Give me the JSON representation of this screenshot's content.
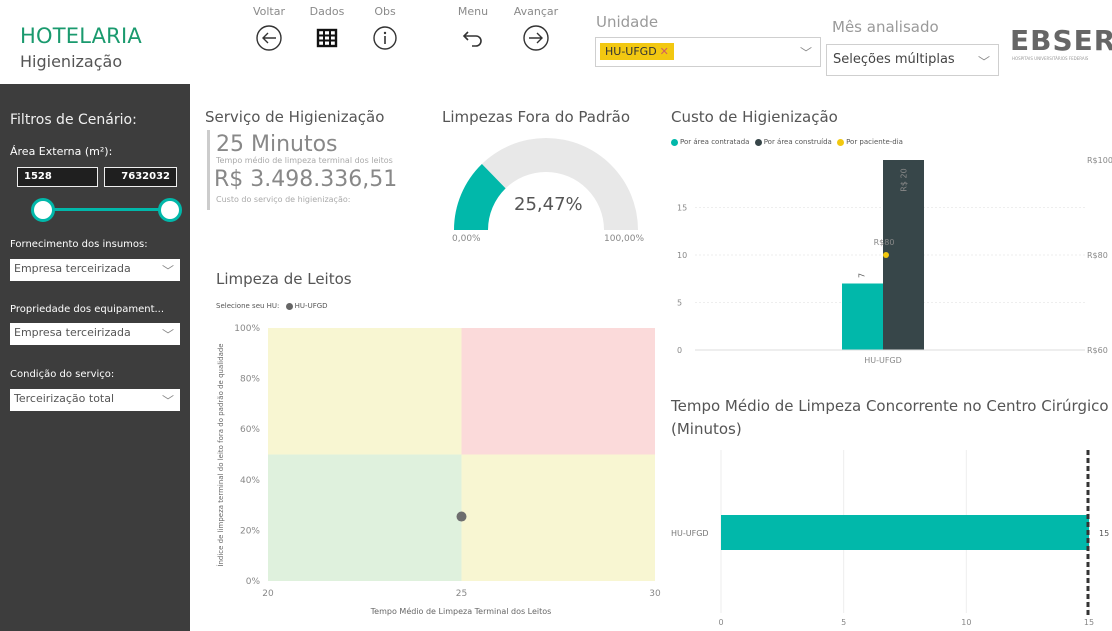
{
  "header": {
    "title": "HOTELARIA",
    "subtitle": "Higienização",
    "nav": [
      {
        "label": "Voltar",
        "icon": "back-arrow-icon"
      },
      {
        "label": "Dados",
        "icon": "table-icon"
      },
      {
        "label": "Obs",
        "icon": "info-icon"
      },
      {
        "label": "Menu",
        "icon": "undo-arrow-icon"
      },
      {
        "label": "Avançar",
        "icon": "forward-arrow-icon"
      }
    ],
    "unidade_label": "Unidade",
    "unidade_chip": "HU-UFGD",
    "mes_label": "Mês analisado",
    "mes_value": "Seleções múltiplas",
    "logo": "EBSERH",
    "logo_sub": "HOSPITAIS UNIVERSITÁRIOS FEDERAIS"
  },
  "sidebar": {
    "title": "Filtros de Cenário:",
    "area_label": "Área Externa (m²):",
    "area_min": "1528",
    "area_max": "7632032",
    "fornecimento_label": "Fornecimento dos insumos:",
    "fornecimento_value": "Empresa terceirizada",
    "propriedade_label": "Propriedade dos equipament...",
    "propriedade_value": "Empresa terceirizada",
    "condicao_label": "Condição do serviço:",
    "condicao_value": "Terceirização total"
  },
  "servico": {
    "title": "Serviço de Higienização",
    "minutes": "25 Minutos",
    "minutes_caption": "Tempo médio de limpeza terminal dos leitos",
    "cost": "R$ 3.498.336,51",
    "cost_caption": "Custo do serviço de higienização:"
  },
  "gauge": {
    "title": "Limpezas Fora do Padrão",
    "value_label": "25,47%",
    "value": 25.47,
    "min_label": "0,00%",
    "max_label": "100,00%",
    "color": "#01b8aa"
  },
  "custo": {
    "title": "Custo de Higienização",
    "legend": [
      {
        "label": "Por área contratada",
        "color": "#01b8aa"
      },
      {
        "label": "Por área construída",
        "color": "#374649"
      },
      {
        "label": "Por paciente-dia",
        "color": "#f2c80f"
      }
    ],
    "y_ticks": [
      "0",
      "5",
      "10",
      "15"
    ],
    "y2_ticks": [
      "R$60",
      "R$80",
      "R$100"
    ],
    "category": "HU-UFGD",
    "bar1_label": "7",
    "bar2_label": "R$ 20",
    "point_label": "R$80"
  },
  "leitos": {
    "title": "Limpeza de Leitos",
    "legend_label": "Selecione seu HU:",
    "legend_item": "HU-UFGD",
    "ylabel": "Índice de limpeza terminal do leito fora do padrão de qualidade",
    "xlabel": "Tempo Médio de Limpeza Terminal dos Leitos",
    "y_ticks": [
      "0%",
      "20%",
      "40%",
      "60%",
      "80%",
      "100%"
    ],
    "x_ticks": [
      "20",
      "25",
      "30"
    ]
  },
  "concorrente": {
    "title_line1": "Tempo Médio de Limpeza Concorrente no Centro Cirúrgico",
    "title_line2": "(Minutos)",
    "category": "HU-UFGD",
    "value_label": "15",
    "x_ticks": [
      "0",
      "5",
      "10",
      "15"
    ]
  },
  "chart_data": [
    {
      "type": "bar",
      "title": "Custo de Higienização",
      "categories": [
        "HU-UFGD"
      ],
      "series": [
        {
          "name": "Por área contratada",
          "values": [
            7
          ]
        },
        {
          "name": "Por área construída",
          "values": [
            20
          ]
        },
        {
          "name": "Por paciente-dia",
          "values": [
            80
          ]
        }
      ],
      "ylim": [
        0,
        20
      ],
      "y2lim": [
        60,
        100
      ]
    },
    {
      "type": "scatter",
      "title": "Limpeza de Leitos",
      "xlabel": "Tempo Médio de Limpeza Terminal dos Leitos",
      "ylabel": "Índice de limpeza terminal do leito fora do padrão de qualidade",
      "series": [
        {
          "name": "HU-UFGD",
          "x": [
            25
          ],
          "y": [
            0.2547
          ]
        }
      ],
      "xlim": [
        20,
        30
      ],
      "ylim": [
        0,
        1
      ]
    },
    {
      "type": "bar",
      "title": "Tempo Médio de Limpeza Concorrente no Centro Cirúrgico (Minutos)",
      "categories": [
        "HU-UFGD"
      ],
      "values": [
        15
      ],
      "xlim": [
        0,
        15
      ]
    }
  ]
}
